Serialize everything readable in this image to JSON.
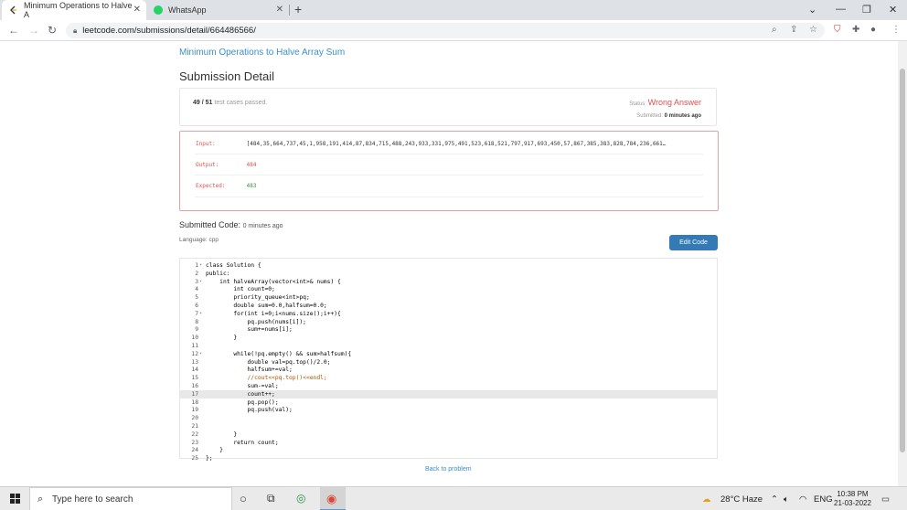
{
  "browser": {
    "tabs": [
      {
        "title": "Minimum Operations to Halve A",
        "active": true
      },
      {
        "title": "WhatsApp",
        "active": false
      }
    ],
    "url": "leetcode.com/submissions/detail/664486566/"
  },
  "page": {
    "problem_link": "Minimum Operations to Halve Array Sum",
    "heading": "Submission Detail",
    "summary": {
      "passed_count": "49 / 51",
      "passed_text": "test cases passed.",
      "status_label": "Status:",
      "status_value": "Wrong Answer",
      "submitted_label": "Submitted:",
      "submitted_value": "0 minutes ago"
    },
    "result": {
      "input_label": "Input:",
      "input_value": "[484,35,664,737,45,1,958,191,414,87,834,715,488,243,933,331,975,491,523,618,521,797,917,693,450,57,867,385,383,828,784,236,661…",
      "output_label": "Output:",
      "output_value": "484",
      "expected_label": "Expected:",
      "expected_value": "483"
    },
    "submitted_code_label": "Submitted Code:",
    "submitted_code_time": "0 minutes ago",
    "language_label": "Language: cpp",
    "edit_button": "Edit Code",
    "back_link": "Back to problem",
    "code_lines": [
      {
        "n": "1",
        "fold": true,
        "text": "class Solution {"
      },
      {
        "n": "2",
        "fold": false,
        "text": "public:"
      },
      {
        "n": "3",
        "fold": true,
        "text": "    int halveArray(vector<int>& nums) {"
      },
      {
        "n": "4",
        "fold": false,
        "text": "        int count=0;"
      },
      {
        "n": "5",
        "fold": false,
        "text": "        priority_queue<int>pq;"
      },
      {
        "n": "6",
        "fold": false,
        "text": "        double sum=0.0,halfsum=0.0;"
      },
      {
        "n": "7",
        "fold": true,
        "text": "        for(int i=0;i<nums.size();i++){"
      },
      {
        "n": "8",
        "fold": false,
        "text": "            pq.push(nums[i]);"
      },
      {
        "n": "9",
        "fold": false,
        "text": "            sum+=nums[i];"
      },
      {
        "n": "10",
        "fold": false,
        "text": "        }"
      },
      {
        "n": "11",
        "fold": false,
        "text": ""
      },
      {
        "n": "12",
        "fold": true,
        "text": "        while(!pq.empty() && sum>halfsum){"
      },
      {
        "n": "13",
        "fold": false,
        "text": "            double val=pq.top()/2.0;"
      },
      {
        "n": "14",
        "fold": false,
        "text": "            halfsum+=val;"
      },
      {
        "n": "15",
        "fold": false,
        "text": "            //cout<<pq.top()<<endl;"
      },
      {
        "n": "16",
        "fold": false,
        "text": "            sum-=val;"
      },
      {
        "n": "17",
        "fold": false,
        "text": "            count++;"
      },
      {
        "n": "18",
        "fold": false,
        "text": "            pq.pop();"
      },
      {
        "n": "19",
        "fold": false,
        "text": "            pq.push(val);"
      },
      {
        "n": "20",
        "fold": false,
        "text": ""
      },
      {
        "n": "21",
        "fold": false,
        "text": ""
      },
      {
        "n": "22",
        "fold": false,
        "text": "        }"
      },
      {
        "n": "23",
        "fold": false,
        "text": "        return count;"
      },
      {
        "n": "24",
        "fold": false,
        "text": "    }"
      },
      {
        "n": "25",
        "fold": false,
        "text": "};"
      }
    ]
  },
  "taskbar": {
    "search_placeholder": "Type here to search",
    "weather": "28°C  Haze",
    "lang": "ENG",
    "time": "10:38 PM",
    "date": "21-03-2022"
  },
  "colors": {
    "wrong_answer": "#d9534f",
    "accent": "#337ab7",
    "expected": "#3c8d40"
  }
}
